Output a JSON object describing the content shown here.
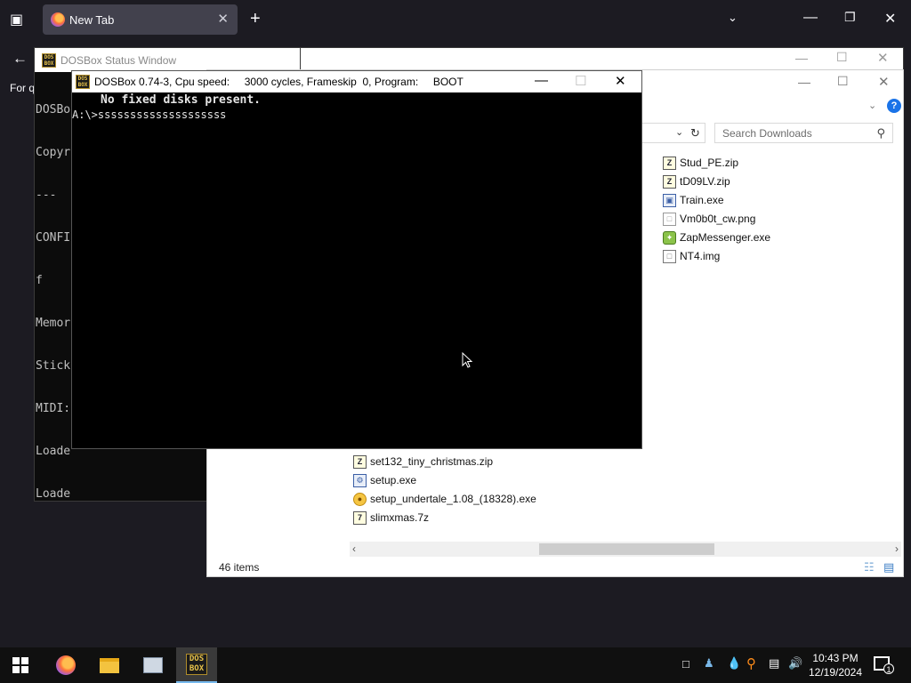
{
  "browser": {
    "tab_title": "New Tab",
    "new_tab_label": "+",
    "nav_text": "For q"
  },
  "status_window": {
    "title": "DOSBox Status Window",
    "lines": [
      "DOSBo",
      "Copyr",
      "---",
      "CONFI",
      "f",
      "Memor",
      "Stick",
      "MIDI:",
      "Loade",
      "Loade"
    ]
  },
  "dosbox": {
    "title": "DOSBox 0.74-3, Cpu speed:     3000 cycles, Frameskip  0, Program:     BOOT",
    "screen_line1": "No fixed disks present.",
    "screen_line2": "A:\\>ssssssssssssssssssss"
  },
  "explorer": {
    "search_placeholder": "Search Downloads",
    "files_top": [
      {
        "name": "Stud_PE.zip",
        "icon": "zip-icon"
      },
      {
        "name": "tD09LV.zip",
        "icon": "zip-icon"
      },
      {
        "name": "Train.exe",
        "icon": "exe-icon"
      },
      {
        "name": "Vm0b0t_cw.png",
        "icon": "png-icon"
      },
      {
        "name": "ZapMessenger.exe",
        "icon": "zap-icon"
      },
      {
        "name": "NT4.img",
        "icon": "img-icon"
      }
    ],
    "files_bottom": [
      {
        "name": "set132_tiny_christmas.zip",
        "icon": "zip-icon"
      },
      {
        "name": "setup.exe",
        "icon": "setup-icon"
      },
      {
        "name": "setup_undertale_1.08_(18328).exe",
        "icon": "undertale-icon"
      },
      {
        "name": "slimxmas.7z",
        "icon": "7z-icon"
      }
    ],
    "item_count": "46 items"
  },
  "taskbar": {
    "time": "10:43 PM",
    "date": "12/19/2024",
    "notification_count": "1"
  }
}
